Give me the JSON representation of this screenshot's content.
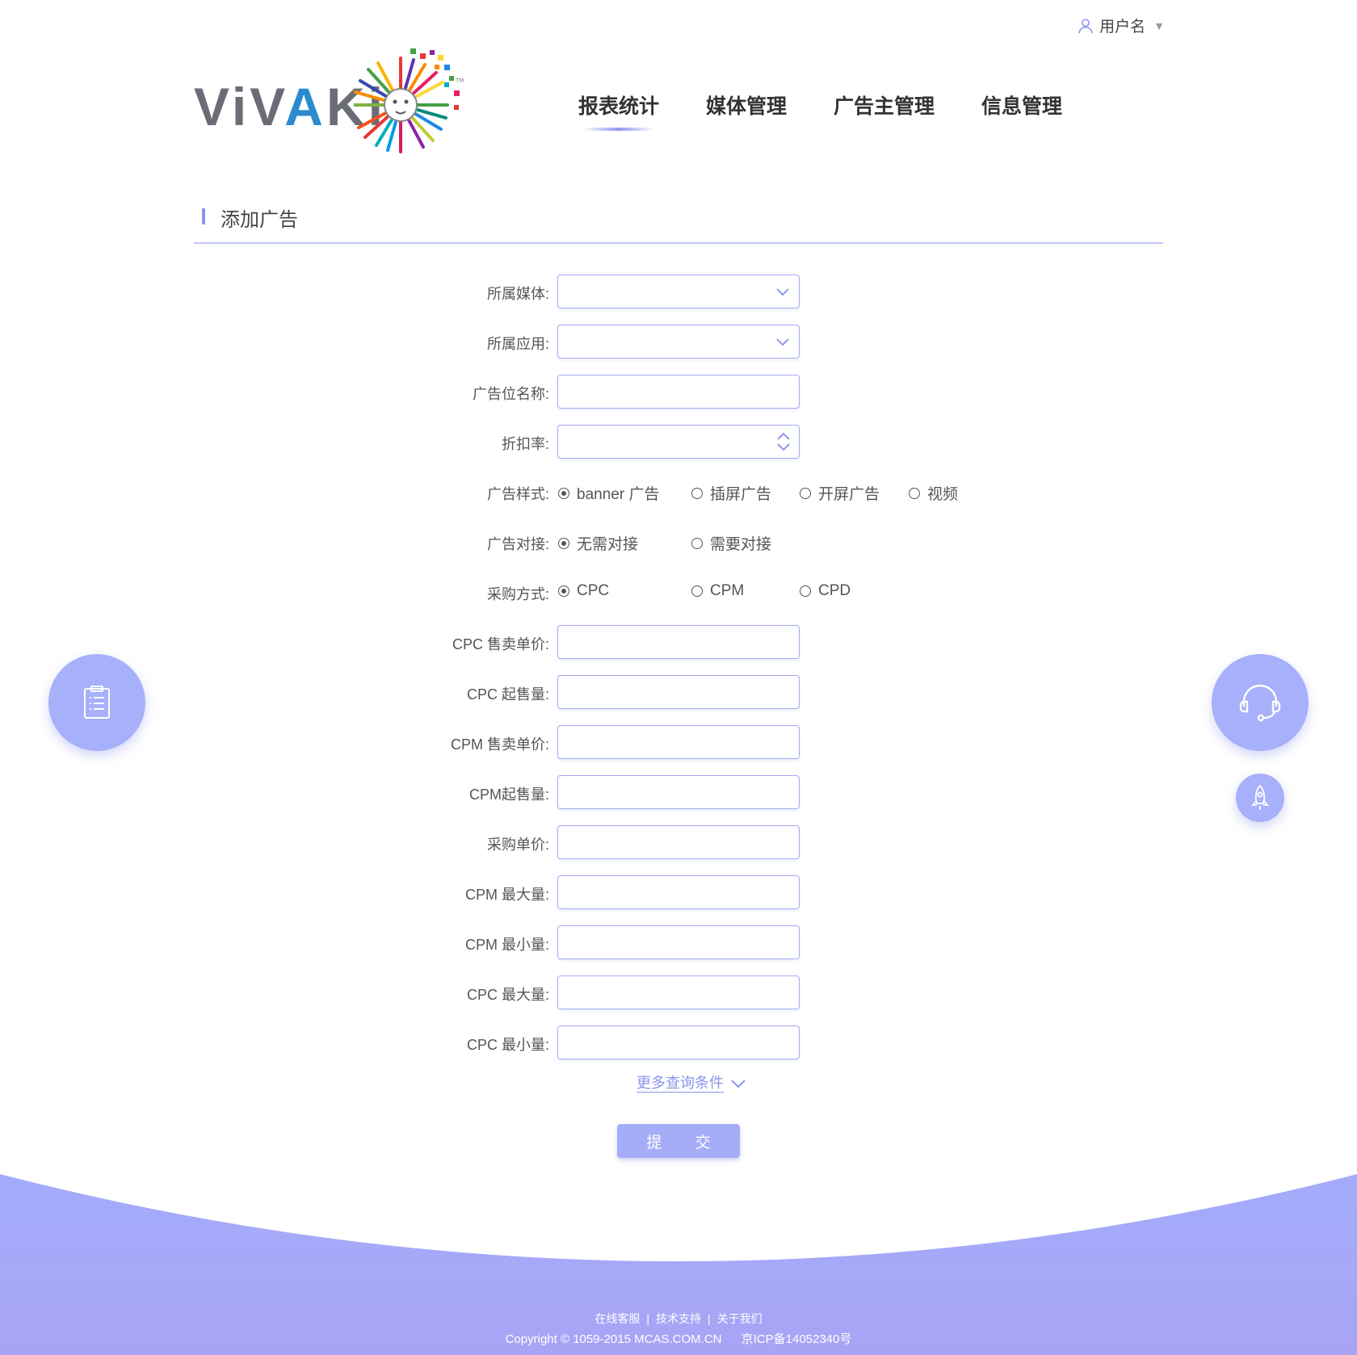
{
  "header": {
    "username": "用户名",
    "logo_text": "ViVAKi"
  },
  "nav": {
    "items": [
      "报表统计",
      "媒体管理",
      "广告主管理",
      "信息管理"
    ],
    "active": "报表统计"
  },
  "section": {
    "title": "添加广告"
  },
  "form": {
    "media_label": "所属媒体:",
    "media_value": "",
    "app_label": "所属应用:",
    "app_value": "",
    "ad_slot_name_label": "广告位名称:",
    "ad_slot_name_value": "",
    "discount_label": "折扣率:",
    "discount_value": "",
    "ad_style": {
      "label": "广告样式:",
      "options": [
        "banner 广告",
        "插屏广告",
        "开屏广告",
        "视频"
      ],
      "selected": "banner 广告"
    },
    "ad_docking": {
      "label": "广告对接:",
      "options": [
        "无需对接",
        "需要对接"
      ],
      "selected": "无需对接"
    },
    "purchase_method": {
      "label": "采购方式:",
      "options": [
        "CPC",
        "CPM",
        "CPD"
      ],
      "selected": "CPC"
    },
    "text_fields": [
      {
        "label": "CPC 售卖单价:",
        "value": ""
      },
      {
        "label": "CPC 起售量:",
        "value": ""
      },
      {
        "label": "CPM 售卖单价:",
        "value": ""
      },
      {
        "label": "CPM起售量:",
        "value": ""
      },
      {
        "label": "采购单价:",
        "value": ""
      },
      {
        "label": "CPM 最大量:",
        "value": ""
      },
      {
        "label": "CPM 最小量:",
        "value": ""
      },
      {
        "label": "CPC 最大量:",
        "value": ""
      },
      {
        "label": "CPC 最小量:",
        "value": ""
      }
    ],
    "more_conditions": "更多查询条件",
    "submit_label": "提 交"
  },
  "floating": {
    "left_icon": "clipboard-list-icon",
    "right_icon": "headset-icon",
    "rocket_icon": "rocket-icon"
  },
  "footer": {
    "links": [
      "在线客服",
      "技术支持",
      "关于我们"
    ],
    "separator": "|",
    "copyright": "Copyright © 1059-2015 MCAS.COM.CN",
    "icp": "京ICP备14052340号"
  },
  "colors": {
    "accent": "#a5adf8",
    "border": "#a3aaf5",
    "wave_top": "#a3acfb",
    "wave_bottom": "#a8a4f5"
  }
}
